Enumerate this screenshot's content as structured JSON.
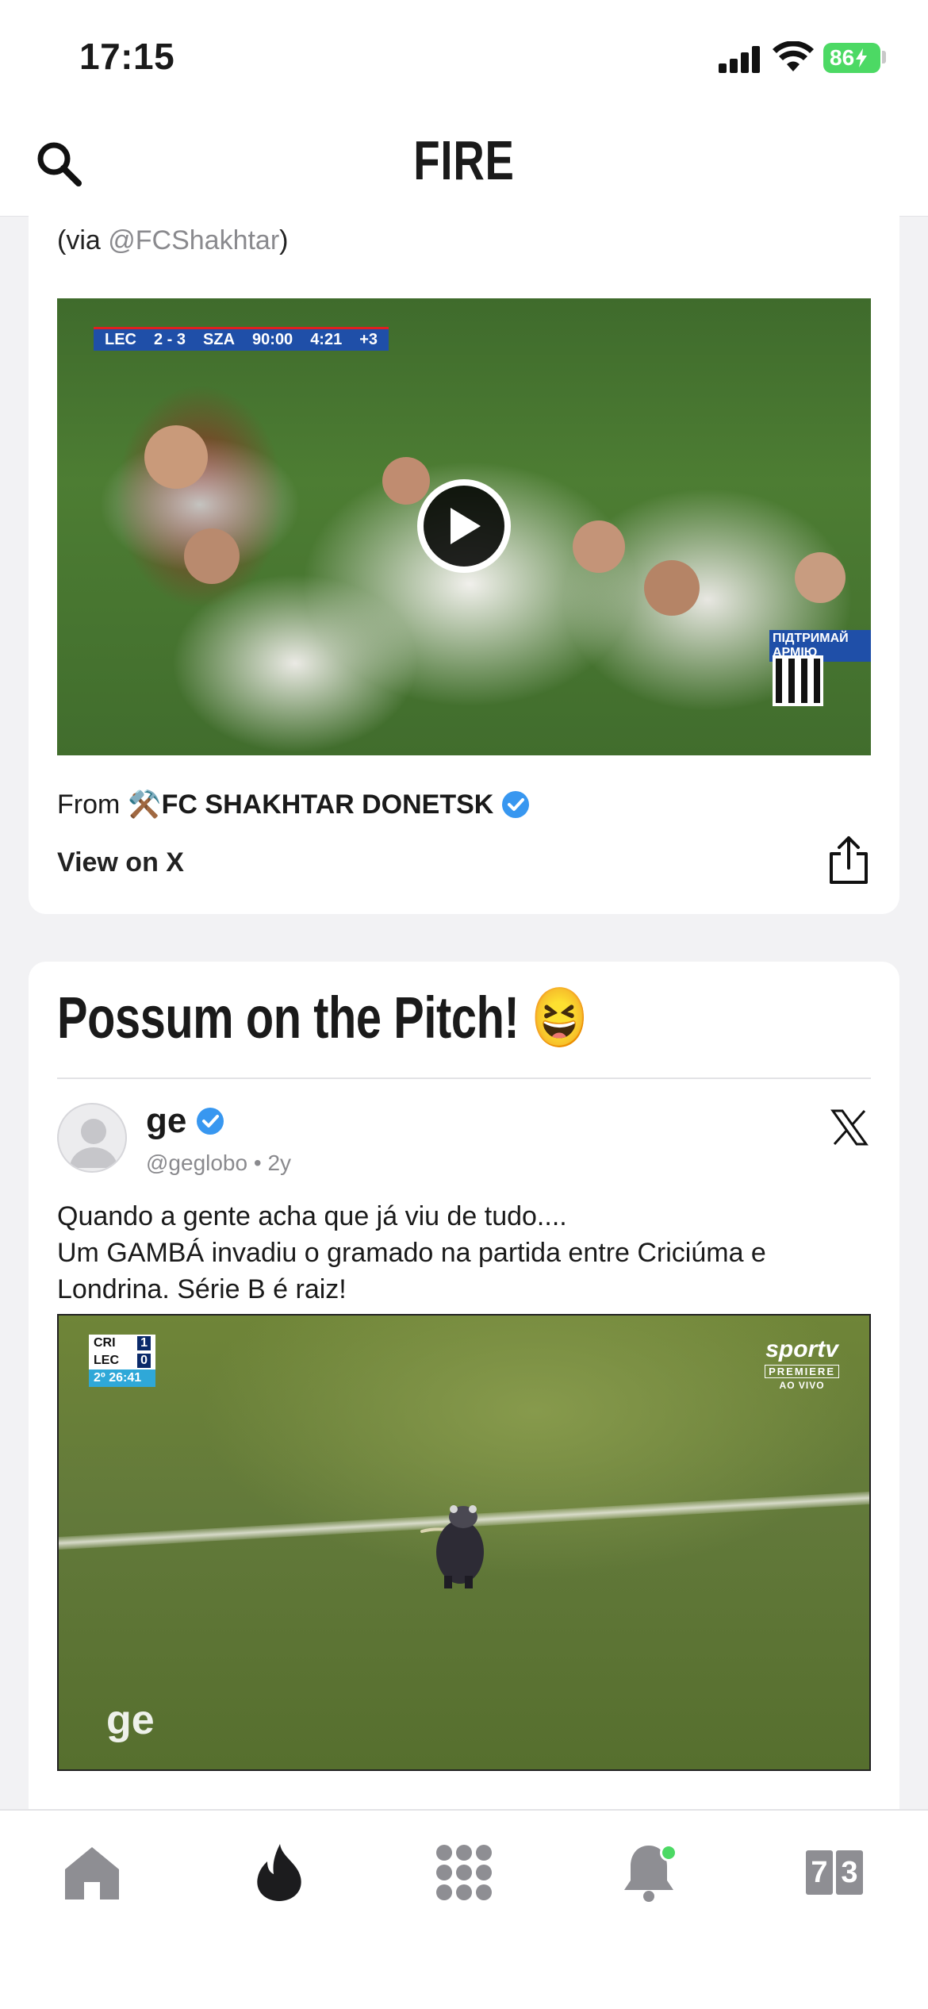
{
  "status_bar": {
    "time": "17:15",
    "battery": "86"
  },
  "header": {
    "title": "FIRE"
  },
  "embed1": {
    "via_prefix": "(via ",
    "via_handle": "@FCShakhtar",
    "via_suffix": ")",
    "scorebug": {
      "home": "LEC",
      "score": "2 - 3",
      "away": "SZA",
      "clock": "90:00",
      "added": "4:21",
      "plus": "+3"
    },
    "qr_label": "ПІДТРИМАЙ АРМІЮ",
    "from_label": "From",
    "org_name": "⚒️FC SHAKHTAR DONETSK",
    "view_on_x": "View on X"
  },
  "card2": {
    "title": "Possum on the Pitch! 😆",
    "author": {
      "name": "ge",
      "handle": "@geglobo",
      "separator": "•",
      "age": "2y"
    },
    "tweet_lines": [
      "Quando a gente acha que já viu de tudo....",
      "Um GAMBÁ invadiu o gramado na partida entre Criciúma e",
      "Londrina. Série B é raiz!"
    ],
    "video": {
      "scorebug": {
        "t1": "CRI",
        "s1": "1",
        "t2": "LEC",
        "s2": "0",
        "clock": "2º 26:41"
      },
      "channel": "sportv",
      "channel_sub": "PREMIERE",
      "channel_live": "AO VIVO",
      "watermark": "ge"
    }
  },
  "tabbar": {
    "items": [
      "home-icon",
      "fire-icon",
      "apps-icon",
      "bell-icon",
      "scores-icon"
    ],
    "scores_digits": [
      "7",
      "3"
    ],
    "colors": {
      "active": "#1c1c1e",
      "inactive": "#8e8e93",
      "notification": "#4cd964"
    }
  }
}
